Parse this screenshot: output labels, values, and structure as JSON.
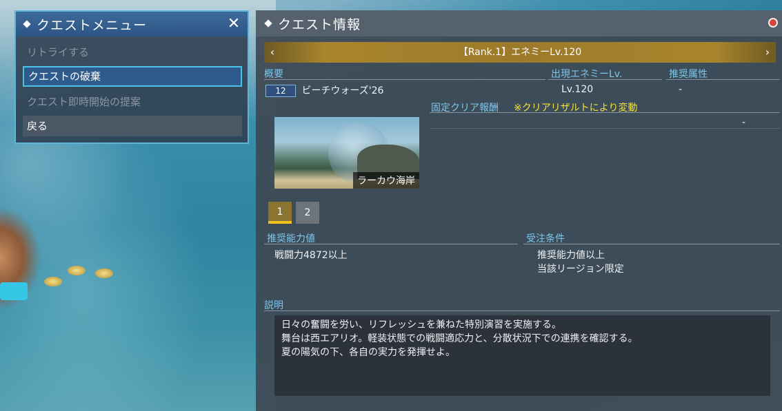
{
  "menu": {
    "title": "クエストメニュー",
    "items": [
      {
        "label": "リトライする",
        "state": "disabled"
      },
      {
        "label": "クエストの破棄",
        "state": "selected"
      },
      {
        "label": "クエスト即時開始の提案",
        "state": "disabled"
      },
      {
        "label": "戻る",
        "state": "normal"
      }
    ]
  },
  "panel": {
    "title": "クエスト情報",
    "rank_label": "【Rank.1】エネミーLv.120",
    "overview_label": "概要",
    "enemy_lv_label": "出現エネミーLv.",
    "element_label": "推奨属性",
    "player_count": "12",
    "quest_name": "ビーチウォーズ'26",
    "enemy_lv_value": "Lv.120",
    "element_value": "-",
    "reward_label": "固定クリア報酬",
    "reward_note": "※クリアリザルトにより変動",
    "reward_value": "-",
    "area_name": "ラーカウ海岸",
    "pages": [
      "1",
      "2"
    ],
    "recommended_power_label": "推奨能力値",
    "recommended_power_value": "戦闘力4872以上",
    "conditions_label": "受注条件",
    "conditions": [
      "推奨能力値以上",
      "当該リージョン限定"
    ],
    "description_label": "説明",
    "description_lines": [
      "日々の奮闘を労い、リフレッシュを兼ねた特別演習を実施する。",
      "舞台は西エアリオ。軽装状態での戦闘適応力と、分散状況下での連携を確認する。",
      "夏の陽気の下、各自の実力を発揮せよ。"
    ]
  },
  "icons": {
    "arrow_left": "‹",
    "arrow_right": "›",
    "close": "✕"
  }
}
